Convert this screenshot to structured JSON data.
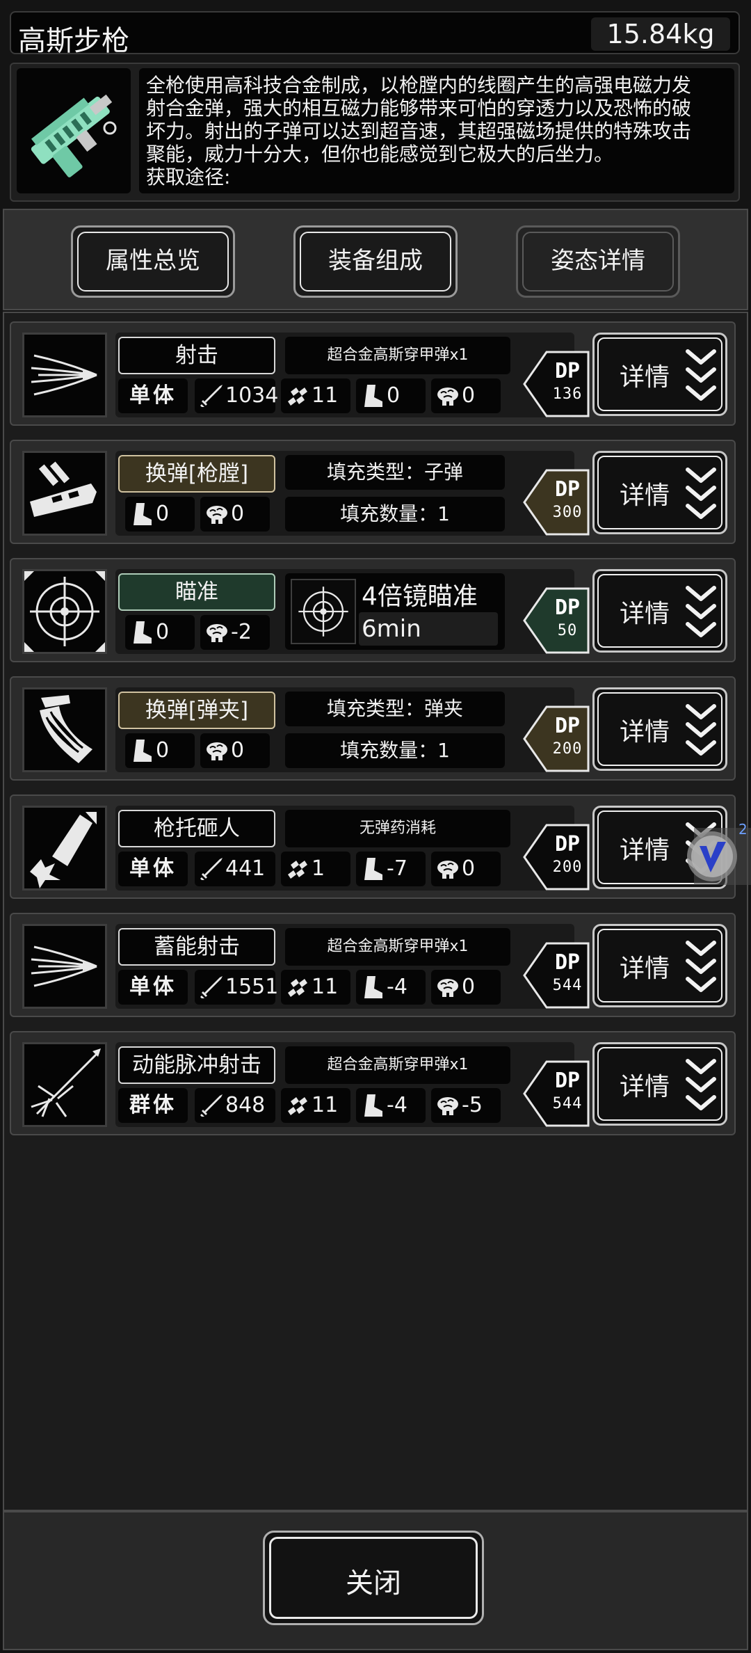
{
  "weapon": {
    "name": "高斯步枪",
    "weight": "15.84kg",
    "icon": "gauss-rifle-icon",
    "description": [
      "全枪使用高科技合金制成，以枪膛内的线圈产生的高强电磁力发",
      "射合金弹，强大的相互磁力能够带来可怕的穿透力以及恐怖的破",
      "坏力。射出的子弹可以达到超音速，其超强磁场提供的特殊攻击",
      "聚能，威力十分大，但你也能感觉到它极大的后坐力。",
      "获取途径:"
    ]
  },
  "tabs": [
    {
      "label": "属性总览",
      "active": false
    },
    {
      "label": "装备组成",
      "active": false
    },
    {
      "label": "姿态详情",
      "active": true
    }
  ],
  "detail_label": "详情",
  "skills": [
    {
      "kind": "attack",
      "name": "射击",
      "ammo": "超合金高斯穿甲弹x1",
      "target": "单体",
      "damage": "1034",
      "accuracy": "11",
      "move": "0",
      "mind": "0",
      "dp_label": "DP",
      "dp": "136",
      "dp_color": "#0a0a0a",
      "icon": "shoot-icon"
    },
    {
      "kind": "reload",
      "name": "换弹[枪膛]",
      "fill_type": "填充类型：子弹",
      "fill_count": "填充数量：1",
      "move": "0",
      "mind": "0",
      "dp_label": "DP",
      "dp": "300",
      "dp_color": "#3c3520",
      "icon": "reload-chamber-icon"
    },
    {
      "kind": "aim",
      "name": "瞄准",
      "aim_name": "4倍镜瞄准",
      "aim_time": "6min",
      "move": "0",
      "mind": "-2",
      "dp_label": "DP",
      "dp": "50",
      "dp_color": "#1f3a2c",
      "icon": "crosshair-icon"
    },
    {
      "kind": "reload",
      "name": "换弹[弹夹]",
      "fill_type": "填充类型：弹夹",
      "fill_count": "填充数量：1",
      "move": "0",
      "mind": "0",
      "dp_label": "DP",
      "dp": "200",
      "dp_color": "#3c3520",
      "icon": "reload-magazine-icon"
    },
    {
      "kind": "attack",
      "name": "枪托砸人",
      "ammo": "无弹药消耗",
      "target": "单体",
      "damage": "441",
      "accuracy": "1",
      "move": "-7",
      "mind": "0",
      "dp_label": "DP",
      "dp": "200",
      "dp_color": "#0a0a0a",
      "icon": "rifle-butt-icon"
    },
    {
      "kind": "attack",
      "name": "蓄能射击",
      "ammo": "超合金高斯穿甲弹x1",
      "target": "单体",
      "damage": "1551",
      "accuracy": "11",
      "move": "-4",
      "mind": "0",
      "dp_label": "DP",
      "dp": "544",
      "dp_color": "#0a0a0a",
      "icon": "charged-shot-icon"
    },
    {
      "kind": "attack",
      "name": "动能脉冲射击",
      "ammo": "超合金高斯穿甲弹x1",
      "target": "群体",
      "damage": "848",
      "accuracy": "11",
      "move": "-4",
      "mind": "-5",
      "dp_label": "DP",
      "dp": "544",
      "dp_color": "#0a0a0a",
      "icon": "pulse-shot-icon"
    }
  ],
  "close_label": "关闭",
  "floating_badge": "2"
}
